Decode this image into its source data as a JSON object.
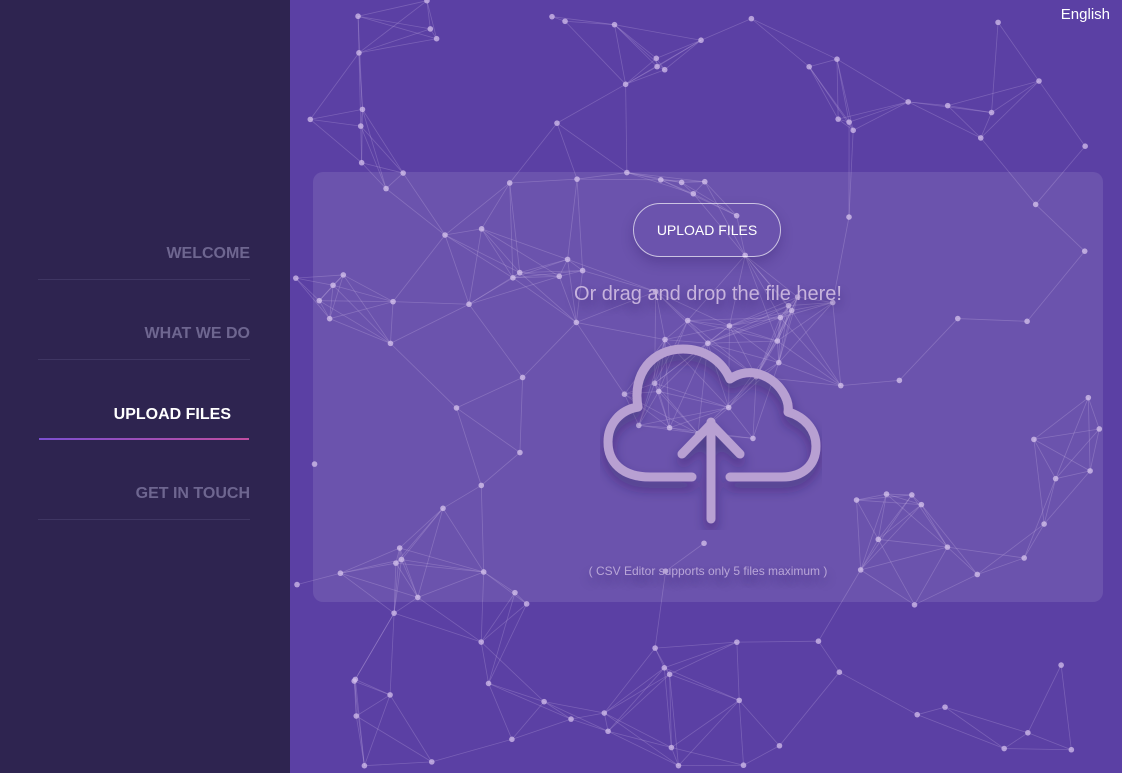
{
  "nav": {
    "items": [
      {
        "label": "WELCOME"
      },
      {
        "label": "WHAT WE DO"
      },
      {
        "label": "UPLOAD FILES"
      },
      {
        "label": "GET IN TOUCH"
      }
    ]
  },
  "header": {
    "language": "English"
  },
  "upload": {
    "button_label": "UPLOAD FILES",
    "drag_text": "Or drag and drop the file here!",
    "note": "( CSV Editor supports only 5 files maximum )",
    "icon": "cloud-upload-icon"
  },
  "colors": {
    "sidebar": "#2e2450",
    "main_bg": "#5b40a4",
    "nav_inactive": "#6e6690",
    "nav_active": "#ffffff",
    "accent_gradient_start": "#7b4fd0",
    "accent_gradient_end": "#c04da0",
    "icon": "#b8a0d2"
  }
}
